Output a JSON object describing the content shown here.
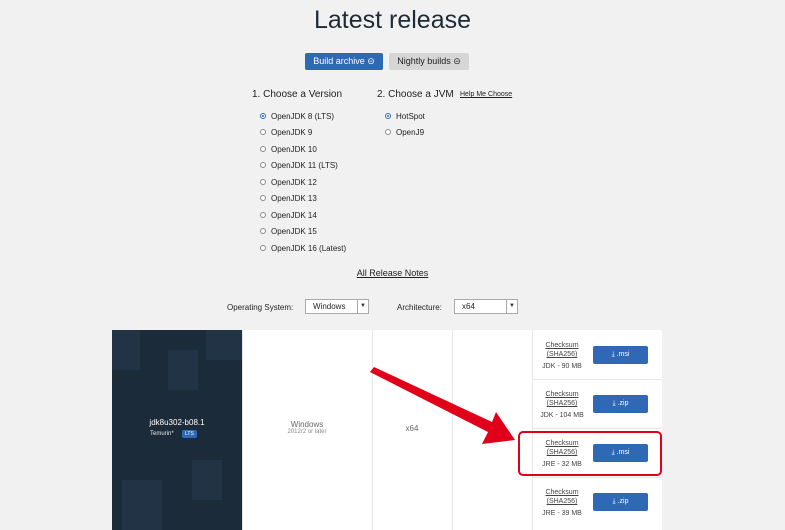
{
  "title": "Latest release",
  "tabs": {
    "build_archive": "Build archive ⊝",
    "nightly_builds": "Nightly builds ⊝"
  },
  "version_section": {
    "header": "1. Choose a Version",
    "options": [
      "OpenJDK 8 (LTS)",
      "OpenJDK 9",
      "OpenJDK 10",
      "OpenJDK 11 (LTS)",
      "OpenJDK 12",
      "OpenJDK 13",
      "OpenJDK 14",
      "OpenJDK 15",
      "OpenJDK 16 (Latest)"
    ],
    "selected": "OpenJDK 8 (LTS)"
  },
  "jvm_section": {
    "header": "2. Choose a JVM",
    "help_link": "Help Me Choose",
    "options": [
      "HotSpot",
      "OpenJ9"
    ],
    "selected": "HotSpot"
  },
  "release_notes_link": "All Release Notes",
  "filters": {
    "os_label": "Operating System:",
    "os_value": "Windows",
    "arch_label": "Architecture:",
    "arch_value": "x64"
  },
  "release": {
    "version": "jdk8u302-b08.1",
    "vendor": "Temurin*",
    "badge": "LTS",
    "os": "Windows",
    "os_sub": "2012r2 or later",
    "arch": "x64",
    "downloads": [
      {
        "checksum": "Checksum",
        "sha": "(SHA256)",
        "size": "JDK - 90 MB",
        "button": "⤓ .msi"
      },
      {
        "checksum": "Checksum",
        "sha": "(SHA256)",
        "size": "JDK - 104 MB",
        "button": "⤓ .zip"
      },
      {
        "checksum": "Checksum",
        "sha": "(SHA256)",
        "size": "JRE - 32 MB",
        "button": "⤓ .msi"
      },
      {
        "checksum": "Checksum",
        "sha": "(SHA256)",
        "size": "JRE - 39 MB",
        "button": "⤓ .zip"
      }
    ]
  },
  "colors": {
    "primary": "#2f68b4",
    "brand_dark": "#1c2b39",
    "highlight": "#e1001a",
    "page_bg": "#f1f1f1"
  }
}
